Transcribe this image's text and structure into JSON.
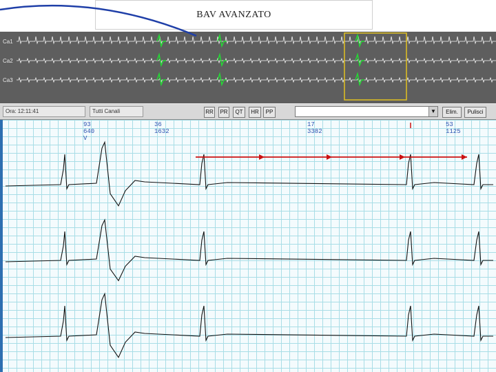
{
  "slide": {
    "title": "BAV AVANZATO"
  },
  "overview": {
    "channels": [
      "Ca1",
      "Ca2",
      "Ca3"
    ]
  },
  "toolbar": {
    "field1": "Ora: 12:11:41",
    "field2": "Tutti Canali",
    "buttons": [
      "RR",
      "PR",
      "QT",
      "HR",
      "PP"
    ],
    "elimina": "Elim.",
    "pulisci": "Pulisci"
  },
  "annotations": [
    {
      "hr": "93",
      "ms": "640",
      "tag": "V"
    },
    {
      "hr": "36",
      "ms": "1632"
    },
    {
      "hr": "17",
      "ms": "3382"
    },
    {
      "hr": "53",
      "ms": "1125"
    }
  ],
  "colors": {
    "overview_bg": "#5e5e5e",
    "trace_normal": "#ffffff",
    "trace_highlight": "#22dd33",
    "selection": "#e0c020",
    "arrow": "#cc1111",
    "grid": "#a8dde6",
    "ecg_trace": "#111111"
  }
}
